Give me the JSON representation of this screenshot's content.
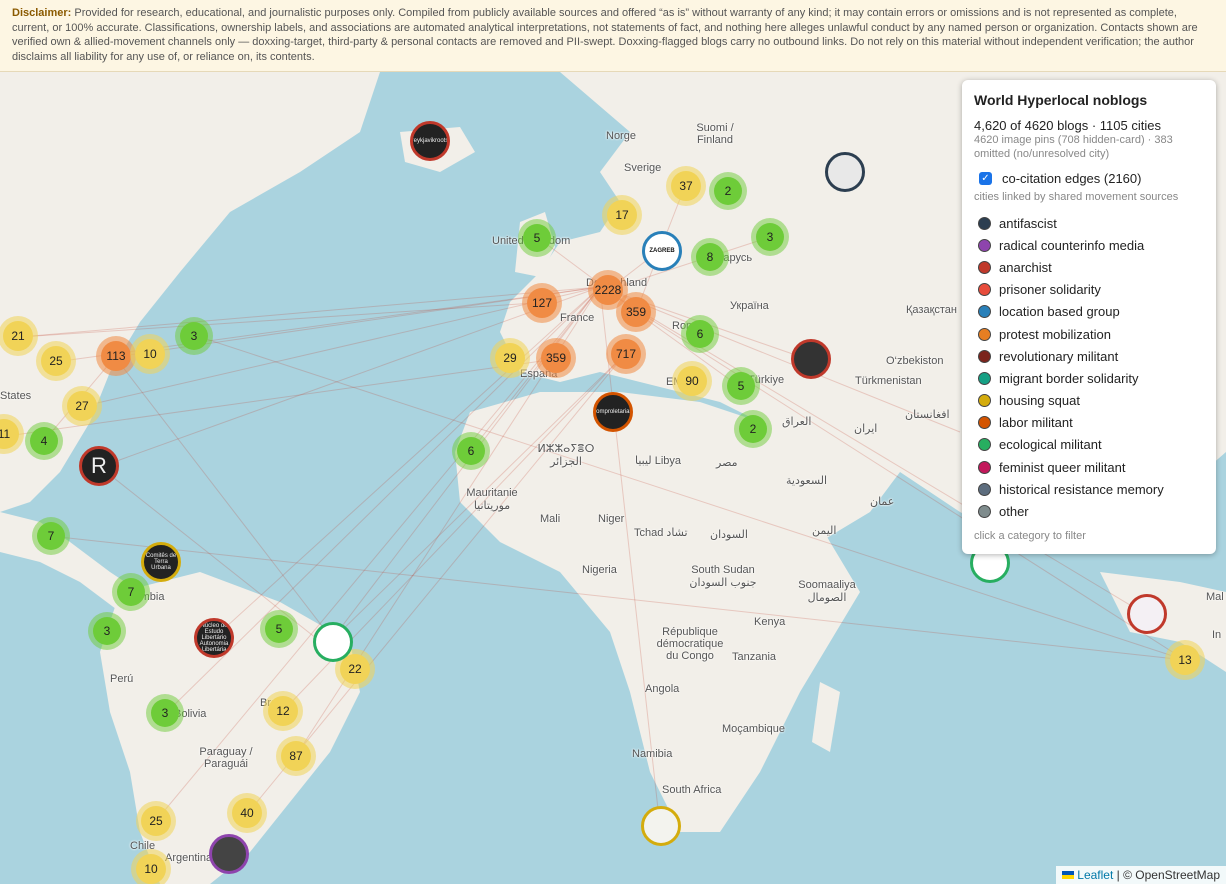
{
  "disclaimer": {
    "label": "Disclaimer:",
    "text": "Provided for research, educational, and journalistic purposes only. Compiled from publicly available sources and offered “as is” without warranty of any kind; it may contain errors or omissions and is not represented as complete, current, or 100% accurate. Classifications, ownership labels, and associations are automated analytical interpretations, not statements of fact, and nothing here alleges unlawful conduct by any named person or organization. Contacts shown are verified own & allied-movement channels only — doxxing-target, third-party & personal contacts are removed and PII-swept. Doxxing-flagged blogs carry no outbound links. Do not rely on this material without independent verification; the author disclaims all liability for any use of, or reliance on, its contents."
  },
  "panel": {
    "title": "World Hyperlocal noblogs",
    "count": "4,620 of 4620 blogs · 1105 cities",
    "pins_note": "4620 image pins (708 hidden-card) · 383 omitted (no/unresolved city)",
    "edges_label": "co-citation edges (2160)",
    "edges_checked": true,
    "edges_note": "cities linked by shared movement sources",
    "categories": [
      {
        "label": "antifascist",
        "color": "#2c3e50"
      },
      {
        "label": "radical counterinfo media",
        "color": "#8e44ad"
      },
      {
        "label": "anarchist",
        "color": "#c0392b"
      },
      {
        "label": "prisoner solidarity",
        "color": "#e74c3c"
      },
      {
        "label": "location based group",
        "color": "#2980b9"
      },
      {
        "label": "protest mobilization",
        "color": "#e67e22"
      },
      {
        "label": "revolutionary militant",
        "color": "#7b241c"
      },
      {
        "label": "migrant border solidarity",
        "color": "#16a085"
      },
      {
        "label": "housing squat",
        "color": "#d4ac0d"
      },
      {
        "label": "labor militant",
        "color": "#d35400"
      },
      {
        "label": "ecological militant",
        "color": "#27ae60"
      },
      {
        "label": "feminist queer militant",
        "color": "#c2185b"
      },
      {
        "label": "historical resistance memory",
        "color": "#5d6d7e"
      },
      {
        "label": "other",
        "color": "#7f8c8d"
      }
    ],
    "hint": "click a category to filter"
  },
  "map_labels": [
    "Norge",
    "Suomi / Finland",
    "Sverige",
    "United Kingdom",
    "Deutschland",
    "France",
    "España",
    "Беларусь",
    "Україна",
    "Қазақстан",
    "O‘zbekiston",
    "Türkmenistan",
    "Türkiye",
    "افغانستان",
    "ایران",
    "العراق",
    "السعودية",
    "عمان",
    "اليمن",
    "مصر",
    "ليبيا Libya",
    "ⵍⵣⵣⴰⵢⴻⵔ الجزائر",
    "Mauritanie موريتانيا",
    "Mali",
    "Niger",
    "Tchad تشاد",
    "السودان",
    "South Sudan جنوب السودان",
    "Soomaaliya الصومال",
    "Nigeria",
    "Kenya",
    "République démocratique du Congo",
    "Tanzania",
    "Angola",
    "Moçambique",
    "Namibia",
    "South Africa",
    "Colombia",
    "Perú",
    "Bolivia",
    "Paraguay / Paraguái",
    "Brasil",
    "Chile",
    "Argentina",
    "States",
    "Mal",
    "In",
    "Rom",
    "EM"
  ],
  "clusters": [
    {
      "n": "2228",
      "c": "o"
    },
    {
      "n": "359",
      "c": "o"
    },
    {
      "n": "127",
      "c": "o"
    },
    {
      "n": "359",
      "c": "o"
    },
    {
      "n": "717",
      "c": "o"
    },
    {
      "n": "113",
      "c": "o"
    },
    {
      "n": "37",
      "c": "y"
    },
    {
      "n": "2",
      "c": "g"
    },
    {
      "n": "17",
      "c": "y"
    },
    {
      "n": "5",
      "c": "g"
    },
    {
      "n": "3",
      "c": "g"
    },
    {
      "n": "8",
      "c": "g"
    },
    {
      "n": "6",
      "c": "g"
    },
    {
      "n": "29",
      "c": "y"
    },
    {
      "n": "90",
      "c": "y"
    },
    {
      "n": "5",
      "c": "g"
    },
    {
      "n": "2",
      "c": "g"
    },
    {
      "n": "6",
      "c": "g"
    },
    {
      "n": "21",
      "c": "y"
    },
    {
      "n": "25",
      "c": "y"
    },
    {
      "n": "10",
      "c": "y"
    },
    {
      "n": "3",
      "c": "g"
    },
    {
      "n": "27",
      "c": "y"
    },
    {
      "n": "11",
      "c": "y"
    },
    {
      "n": "4",
      "c": "g"
    },
    {
      "n": "7",
      "c": "g"
    },
    {
      "n": "7",
      "c": "g"
    },
    {
      "n": "3",
      "c": "g"
    },
    {
      "n": "5",
      "c": "g"
    },
    {
      "n": "22",
      "c": "y"
    },
    {
      "n": "3",
      "c": "g"
    },
    {
      "n": "12",
      "c": "y"
    },
    {
      "n": "87",
      "c": "y"
    },
    {
      "n": "40",
      "c": "y"
    },
    {
      "n": "25",
      "c": "y"
    },
    {
      "n": "10",
      "c": "y"
    },
    {
      "n": "13",
      "c": "y"
    }
  ],
  "pins": [
    {
      "text": "reykjavikroots",
      "border": "#c0392b"
    },
    {
      "text": "",
      "border": "#2c3e50"
    },
    {
      "text": "ZAGREB",
      "border": "#2980b9"
    },
    {
      "text": "",
      "border": "#c0392b"
    },
    {
      "text": "comproletarian",
      "border": "#d35400"
    },
    {
      "text": "R",
      "border": "#c0392b"
    },
    {
      "text": "Comitês de Terra Urbana",
      "border": "#d4ac0d"
    },
    {
      "text": "Núcleo de Estudo Libertário Autonomia Libertária",
      "border": "#c0392b"
    },
    {
      "text": "",
      "border": "#27ae60"
    },
    {
      "text": "",
      "border": "#8e44ad"
    },
    {
      "text": "",
      "border": "#d4ac0d"
    },
    {
      "text": "",
      "border": "#c0392b"
    },
    {
      "text": "",
      "border": "#27ae60"
    }
  ],
  "attribution": {
    "leaflet": "Leaflet",
    "rest": "| © OpenStreetMap"
  }
}
